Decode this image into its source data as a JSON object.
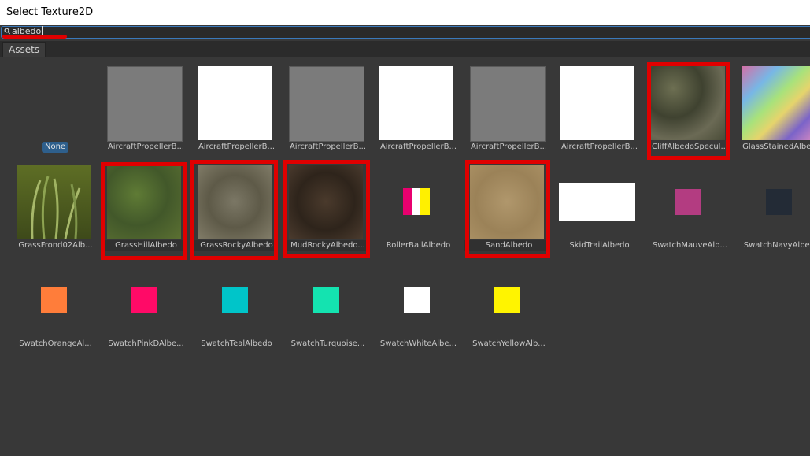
{
  "window": {
    "title": "Select Texture2D"
  },
  "search": {
    "value": "albedo"
  },
  "tabs": [
    {
      "label": "Assets"
    }
  ],
  "none_label": "None",
  "items": [
    {
      "label": "AircraftPropellerB...",
      "color": "#7b7b7b"
    },
    {
      "label": "AircraftPropellerB...",
      "color": "#ffffff"
    },
    {
      "label": "AircraftPropellerB...",
      "color": "#7b7b7b"
    },
    {
      "label": "AircraftPropellerB...",
      "color": "#ffffff"
    },
    {
      "label": "AircraftPropellerB...",
      "color": "#7b7b7b"
    },
    {
      "label": "AircraftPropellerB...",
      "color": "#ffffff"
    },
    {
      "label": "CliffAlbedoSpecul...",
      "color": "#55583f"
    },
    {
      "label": "GlassStainedAlbe...",
      "color": "#8a7fb6"
    },
    {
      "label": "GrassFrond02Alb...",
      "color": "#4b5a22"
    },
    {
      "label": "GrassHillAlbedo",
      "color": "#4e6a2c"
    },
    {
      "label": "GrassRockyAlbedo",
      "color": "#6e6a58"
    },
    {
      "label": "MudRockyAlbedo...",
      "color": "#3e3026"
    },
    {
      "label": "RollerBallAlbedo",
      "color": "#ffffff"
    },
    {
      "label": "SandAlbedo",
      "color": "#a88e64"
    },
    {
      "label": "SkidTrailAlbedo",
      "color": "#ffffff"
    },
    {
      "label": "SwatchMauveAlb...",
      "color": "#b33c81"
    },
    {
      "label": "SwatchNavyAlbe...",
      "color": "#232b36"
    },
    {
      "label": "SwatchOrangeAl...",
      "color": "#ff7d3a"
    },
    {
      "label": "SwatchPinkDAlbe...",
      "color": "#ff0a67"
    },
    {
      "label": "SwatchTealAlbedo",
      "color": "#00c5c9"
    },
    {
      "label": "SwatchTurquoise...",
      "color": "#14e3b0"
    },
    {
      "label": "SwatchWhiteAlbe...",
      "color": "#ffffff"
    },
    {
      "label": "SwatchYellowAlb...",
      "color": "#fff400"
    }
  ],
  "highlight_color": "#e00000"
}
